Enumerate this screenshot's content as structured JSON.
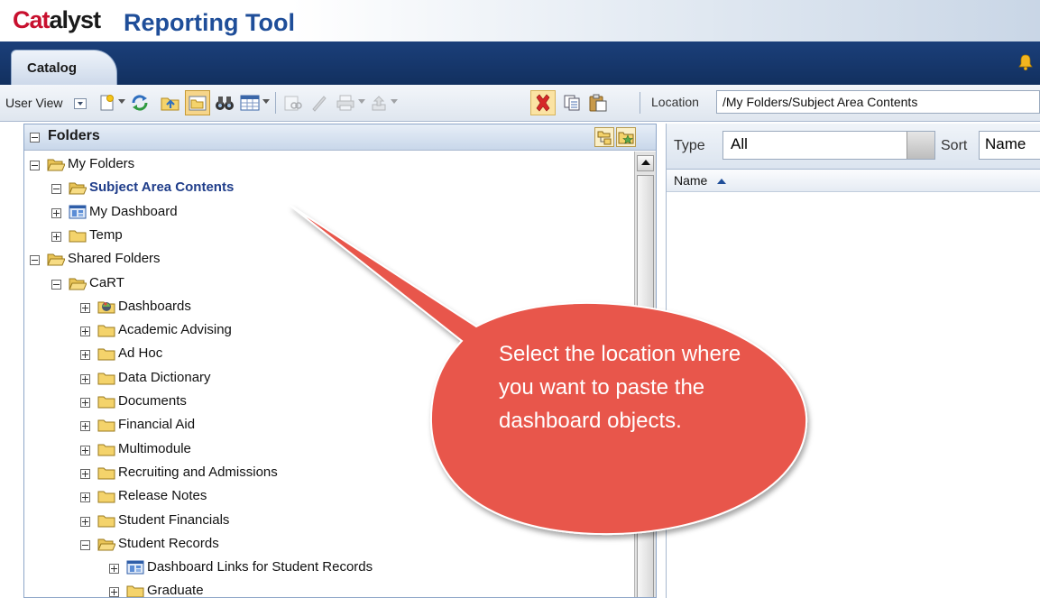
{
  "header": {
    "brand_part1": "Cat",
    "brand_part2": "alyst",
    "title": "Reporting Tool"
  },
  "tabs": [
    {
      "label": "Catalog",
      "active": true
    }
  ],
  "toolbar": {
    "user_view_label": "User View",
    "location_label": "Location",
    "location_value": "/My Folders/Subject Area Contents",
    "icons": [
      "new-icon",
      "refresh-icon",
      "up-folder-icon",
      "folder-view-icon",
      "search-icon",
      "grid-view-icon",
      "properties-icon",
      "rename-icon",
      "print-icon",
      "upload-icon",
      "delete-icon",
      "copy-icon",
      "paste-icon"
    ]
  },
  "folders_pane": {
    "title": "Folders",
    "tree": [
      {
        "label": "My Folders",
        "level": 0,
        "expander": "minus",
        "icon": "open-folder"
      },
      {
        "label": "Subject Area Contents",
        "level": 1,
        "expander": "minus",
        "icon": "open-folder",
        "selected": true
      },
      {
        "label": "My Dashboard",
        "level": 1,
        "expander": "plus",
        "icon": "dashboard"
      },
      {
        "label": "Temp",
        "level": 1,
        "expander": "plus",
        "icon": "folder"
      },
      {
        "label": "Shared Folders",
        "level": 0,
        "expander": "minus",
        "icon": "open-folder"
      },
      {
        "label": "CaRT",
        "level": 1,
        "expander": "minus",
        "icon": "open-folder"
      },
      {
        "label": "Dashboards",
        "level": 2,
        "expander": "plus",
        "icon": "dashboards-folder"
      },
      {
        "label": "Academic Advising",
        "level": 2,
        "expander": "plus",
        "icon": "folder"
      },
      {
        "label": "Ad Hoc",
        "level": 2,
        "expander": "plus",
        "icon": "folder"
      },
      {
        "label": "Data Dictionary",
        "level": 2,
        "expander": "plus",
        "icon": "folder"
      },
      {
        "label": "Documents",
        "level": 2,
        "expander": "plus",
        "icon": "folder"
      },
      {
        "label": "Financial Aid",
        "level": 2,
        "expander": "plus",
        "icon": "folder"
      },
      {
        "label": "Multimodule",
        "level": 2,
        "expander": "plus",
        "icon": "folder"
      },
      {
        "label": "Recruiting and Admissions",
        "level": 2,
        "expander": "plus",
        "icon": "folder"
      },
      {
        "label": "Release Notes",
        "level": 2,
        "expander": "plus",
        "icon": "folder"
      },
      {
        "label": "Student Financials",
        "level": 2,
        "expander": "plus",
        "icon": "folder"
      },
      {
        "label": "Student Records",
        "level": 2,
        "expander": "minus",
        "icon": "open-folder"
      },
      {
        "label": "Dashboard Links for Student Records",
        "level": 3,
        "expander": "plus",
        "icon": "dashboard"
      },
      {
        "label": "Graduate",
        "level": 3,
        "expander": "plus",
        "icon": "folder"
      }
    ]
  },
  "right_pane": {
    "type_label": "Type",
    "type_value": "All",
    "sort_label": "Sort",
    "sort_value": "Name",
    "column_header": "Name"
  },
  "callout": {
    "text": "Select the location where you want to paste the dashboard objects.",
    "color": "#e8574b"
  }
}
